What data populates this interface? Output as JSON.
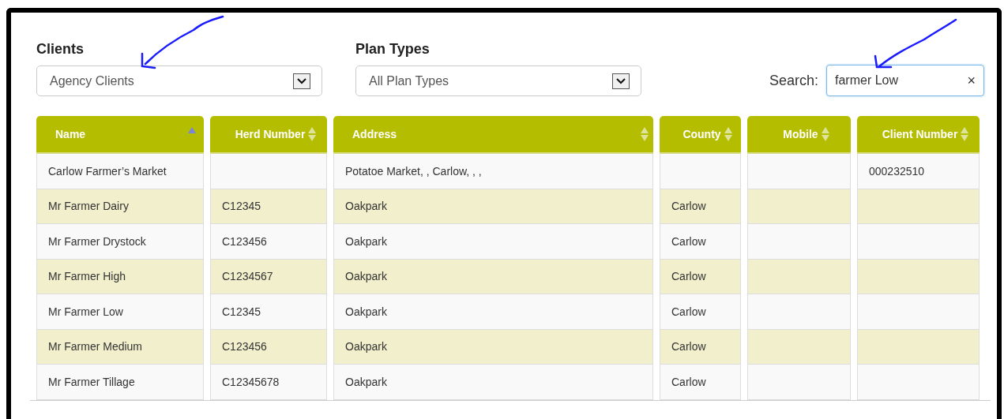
{
  "filters": [
    {
      "kind": "dropdown",
      "label": "Clients",
      "value": "Agency Clients"
    },
    {
      "kind": "dropdown",
      "label": "Plan Types",
      "value": "All Plan Types"
    }
  ],
  "search": {
    "label": "Search:",
    "value": "farmer Low",
    "clear": "×"
  },
  "table": {
    "columns": [
      {
        "label": "Name",
        "sorted": true
      },
      {
        "label": "Herd Number",
        "sorted": false
      },
      {
        "label": "Address",
        "sorted": false
      },
      {
        "label": "County",
        "sorted": false
      },
      {
        "label": "Mobile",
        "sorted": false
      },
      {
        "label": "Client Number",
        "sorted": false
      }
    ],
    "rows": [
      [
        "Carlow Farmer’s Market",
        null,
        "Potatoe Market, , Carlow, , ,",
        null,
        null,
        "000232510"
      ],
      [
        "Mr Farmer Dairy",
        "C12345",
        "Oakpark",
        "Carlow",
        null,
        null
      ],
      [
        "Mr Farmer Drystock",
        "C123456",
        "Oakpark",
        "Carlow",
        null,
        null
      ],
      [
        "Mr Farmer High",
        "C1234567",
        "Oakpark",
        "Carlow",
        null,
        null
      ],
      [
        "Mr Farmer Low",
        "C12345",
        "Oakpark",
        "Carlow",
        null,
        null
      ],
      [
        "Mr Farmer Medium",
        "C123456",
        "Oakpark",
        "Carlow",
        null,
        null
      ],
      [
        "Mr Farmer Tillage",
        "C12345678",
        "Oakpark",
        "Carlow",
        null,
        null
      ]
    ]
  }
}
